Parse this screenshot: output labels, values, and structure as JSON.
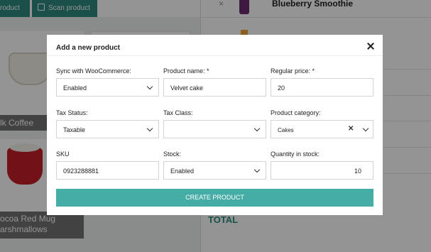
{
  "background": {
    "toolbar": {
      "left_button_label": "roduct",
      "scan_button_label": "Scan product"
    },
    "products": [
      {
        "caption": "lk Coffee"
      },
      {
        "caption": "ocoa Red Mug"
      },
      {
        "caption_line2": "arshmallows"
      }
    ],
    "cart": {
      "item_title": "Blueberry Smoothie",
      "total_label": "TOTAL"
    }
  },
  "modal": {
    "title": "Add a new product",
    "fields": {
      "sync": {
        "label": "Sync with WooCommerce:",
        "value": "Enabled"
      },
      "name": {
        "label": "Product name: *",
        "value": "Velvet cake"
      },
      "price": {
        "label": "Regular price: *",
        "value": "20"
      },
      "tax_status": {
        "label": "Tax Status:",
        "value": "Taxable"
      },
      "tax_class": {
        "label": "Tax Class:",
        "value": ""
      },
      "category": {
        "label": "Product category:",
        "value": "Cakes"
      },
      "sku": {
        "label": "SKU",
        "value": "0923288881"
      },
      "stock": {
        "label": "Stock:",
        "value": "Enabled"
      },
      "quantity": {
        "label": "Quantity in stock:",
        "value": "10"
      }
    },
    "submit_label": "CREATE PRODUCT"
  },
  "colors": {
    "accent": "#46aca6",
    "overlay": "rgba(0,0,0,0.42)"
  }
}
